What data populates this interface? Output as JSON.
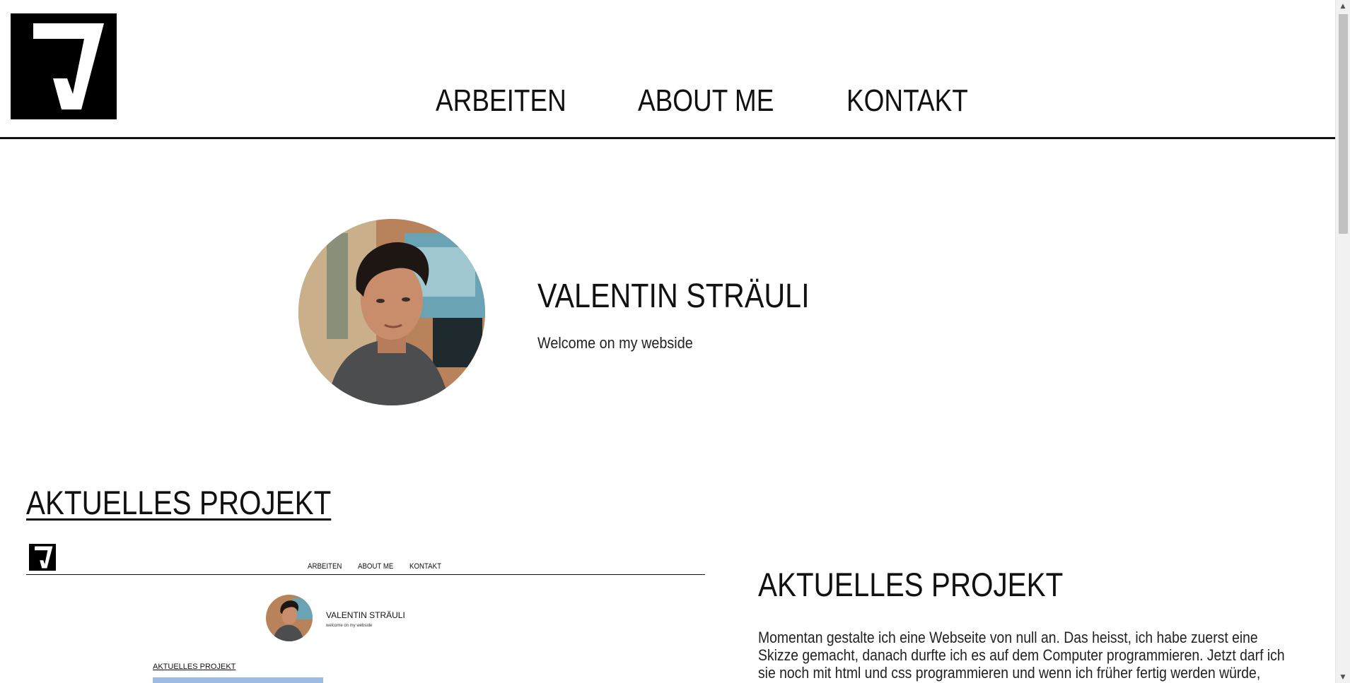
{
  "nav": {
    "items": [
      "ARBEITEN",
      "ABOUT ME",
      "KONTAKT"
    ]
  },
  "hero": {
    "name": "VALENTIN STRÄULI",
    "subtitle": "Welcome on my webside"
  },
  "section": {
    "title": "AKTUELLES PROJEKT"
  },
  "preview": {
    "nav": [
      "ARBEITEN",
      "ABOUT ME",
      "KONTAKT"
    ],
    "name": "VALENTIN STRÄULI",
    "subtitle": "welcome on my webside",
    "section_title": "AKTUELLES PROJEKT"
  },
  "project": {
    "heading": "AKTUELLES PROJEKT",
    "text": "Momentan gestalte ich eine Webseite von null an. Das heisst, ich habe zuerst eine Skizze gemacht, danach durfte ich es auf dem Computer programmieren. Jetzt darf ich sie noch mit html und css programmieren und wenn ich früher fertig werden würde, dann"
  },
  "scrollbar": {
    "up_icon": "triangle-up-icon",
    "down_icon": "triangle-down-icon"
  },
  "colors": {
    "background": "#ffffff",
    "text": "#111111",
    "logo": "#000000",
    "preview_accent": "#9dbbe3"
  }
}
